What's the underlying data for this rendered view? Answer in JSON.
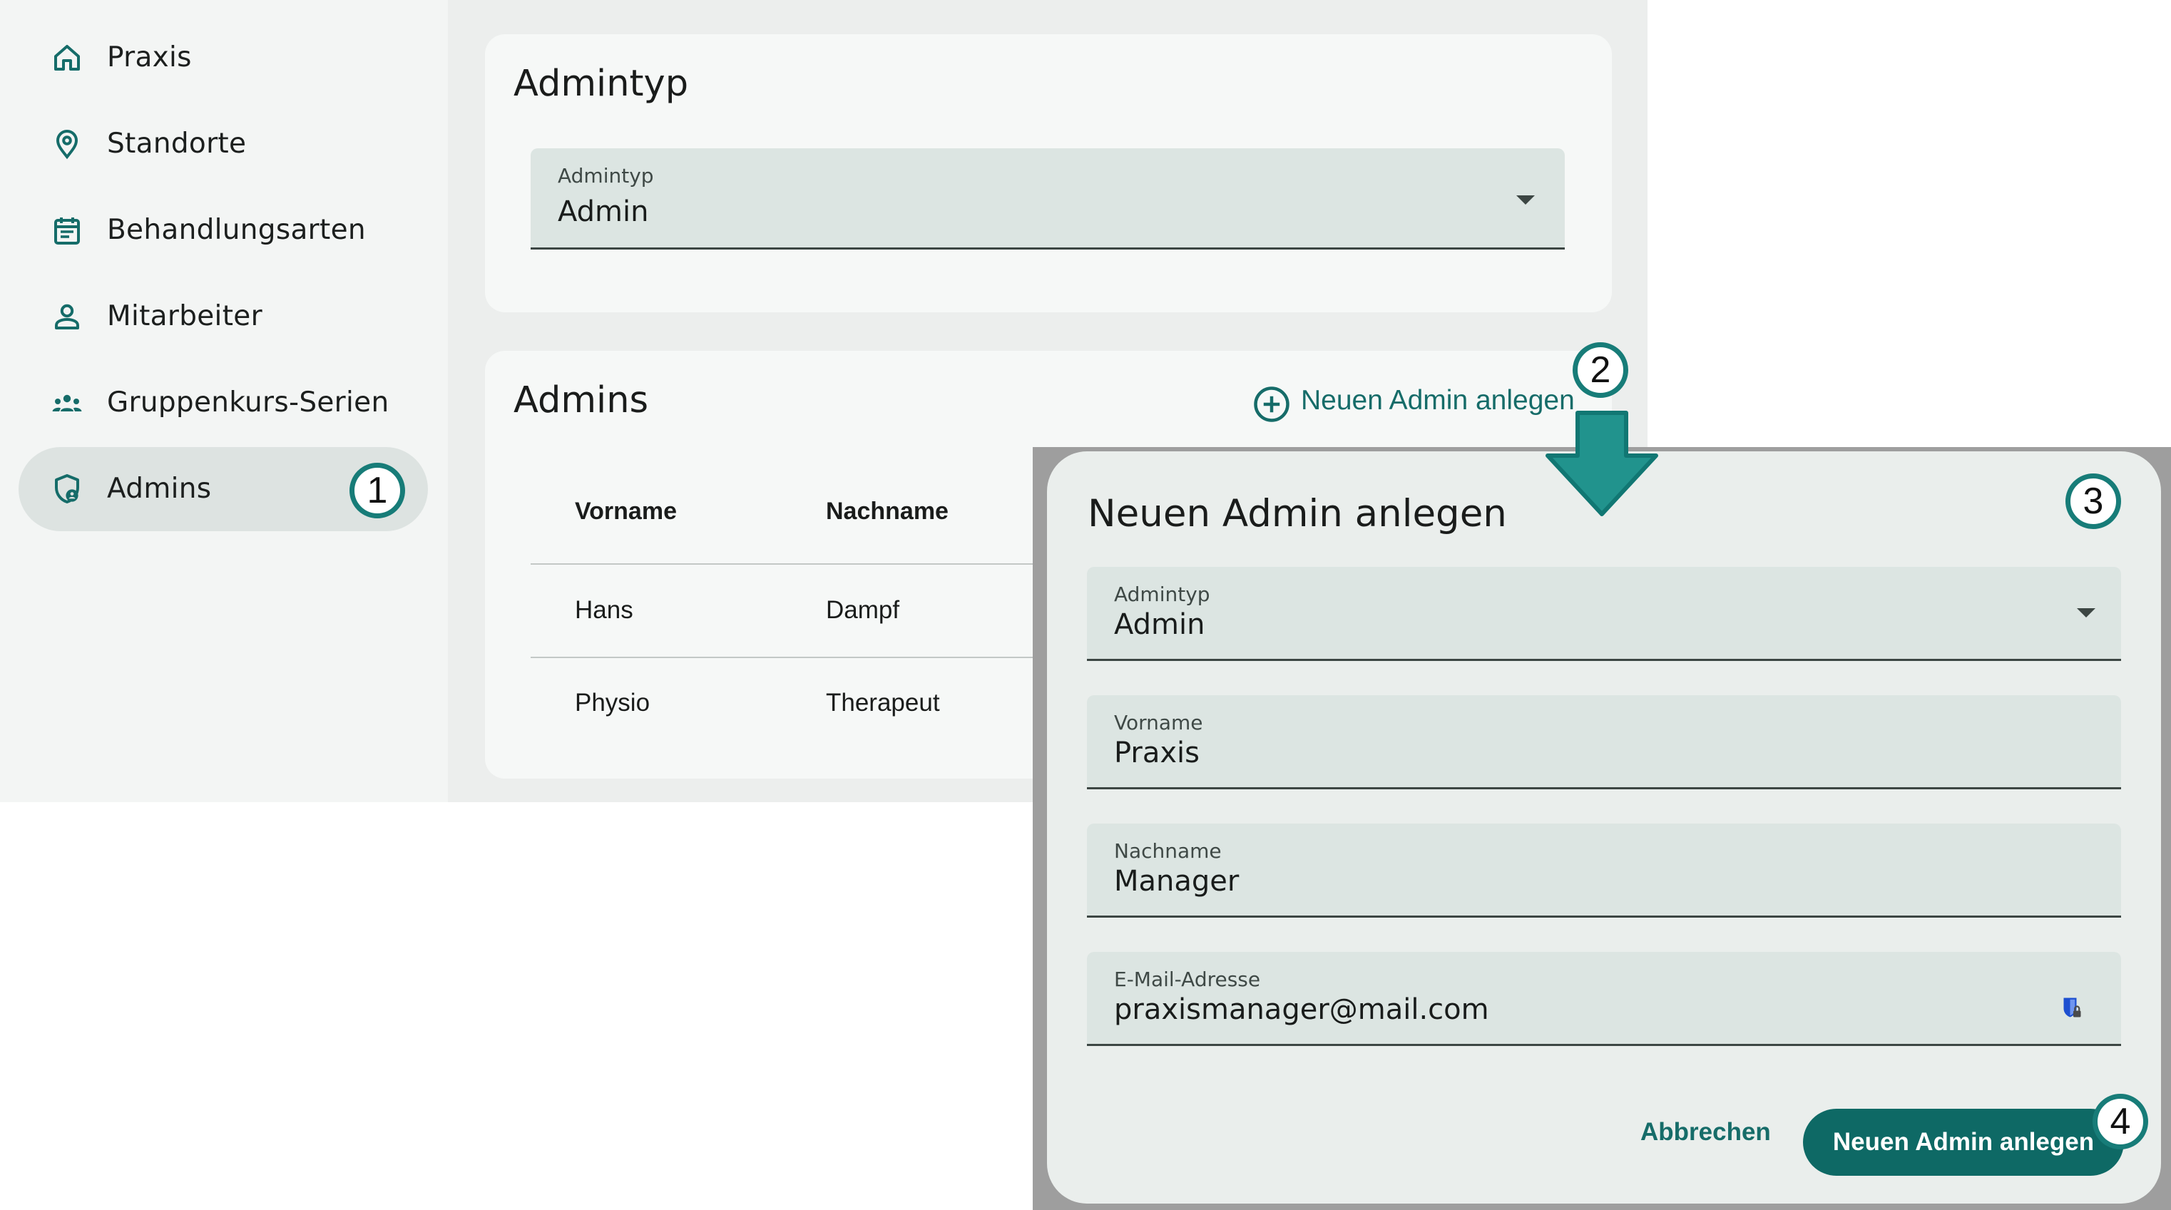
{
  "sidebar": {
    "items": [
      {
        "label": "Praxis",
        "icon": "home-icon"
      },
      {
        "label": "Standorte",
        "icon": "location-pin-icon"
      },
      {
        "label": "Behandlungsarten",
        "icon": "calendar-icon"
      },
      {
        "label": "Mitarbeiter",
        "icon": "person-icon"
      },
      {
        "label": "Gruppenkurs-Serien",
        "icon": "group-icon"
      },
      {
        "label": "Admins",
        "icon": "admin-shield-icon",
        "active": true
      }
    ]
  },
  "admintyp_card": {
    "title": "Admintyp",
    "field_label": "Admintyp",
    "field_value": "Admin"
  },
  "admins_card": {
    "title": "Admins",
    "add_label": "Neuen Admin anlegen",
    "columns": [
      "Vorname",
      "Nachname"
    ],
    "rows": [
      [
        "Hans",
        "Dampf"
      ],
      [
        "Physio",
        "Therapeut"
      ]
    ]
  },
  "dialog": {
    "title": "Neuen Admin anlegen",
    "fields": [
      {
        "label": "Admintyp",
        "value": "Admin"
      },
      {
        "label": "Vorname",
        "value": "Praxis"
      },
      {
        "label": "Nachname",
        "value": "Manager"
      },
      {
        "label": "E-Mail-Adresse",
        "value": "praxismanager@mail.com"
      }
    ],
    "cancel_label": "Abbrechen",
    "submit_label": "Neuen Admin anlegen"
  },
  "annotations": [
    "1",
    "2",
    "3",
    "4"
  ],
  "colors": {
    "accent": "#0e6965",
    "badge_border": "#177c78",
    "arrow": "#21938d",
    "field_bg": "#dce5e2"
  }
}
